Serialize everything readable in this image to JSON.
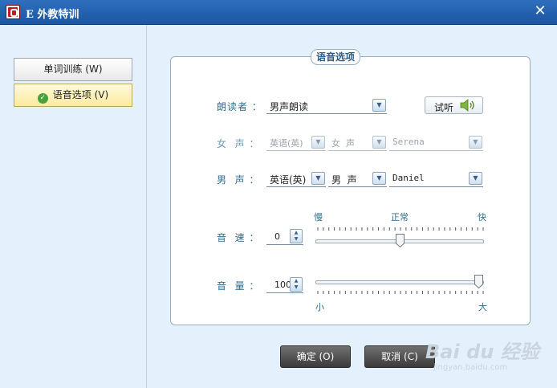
{
  "window": {
    "title": "E 外教特训"
  },
  "sidebar": {
    "items": [
      {
        "label": "单词训练 (W)"
      },
      {
        "label": "语音选项 (V)"
      }
    ]
  },
  "group": {
    "title": "语音选项"
  },
  "reader": {
    "label": "朗读者 ：",
    "value": "男声朗读"
  },
  "listen": {
    "label": "试听"
  },
  "female": {
    "label": "女  声 ：",
    "language": "英语(英)",
    "gender": "女  声",
    "voice": "Serena"
  },
  "male": {
    "label": "男  声 ：",
    "language": "英语(英)",
    "gender": "男  声",
    "voice": "Daniel"
  },
  "speed": {
    "label": "音  速 ：",
    "value": "0",
    "level": 0.5,
    "scale_slow": "慢",
    "scale_normal": "正常",
    "scale_fast": "快"
  },
  "volume": {
    "label": "音  量 ：",
    "value": "100",
    "level": 1.0,
    "scale_low": "小",
    "scale_high": "大"
  },
  "buttons": {
    "ok": "确定 (O)",
    "cancel": "取消 (C)"
  },
  "watermark": {
    "main": "Bai du 经验",
    "sub": "jingyan.baidu.com"
  }
}
